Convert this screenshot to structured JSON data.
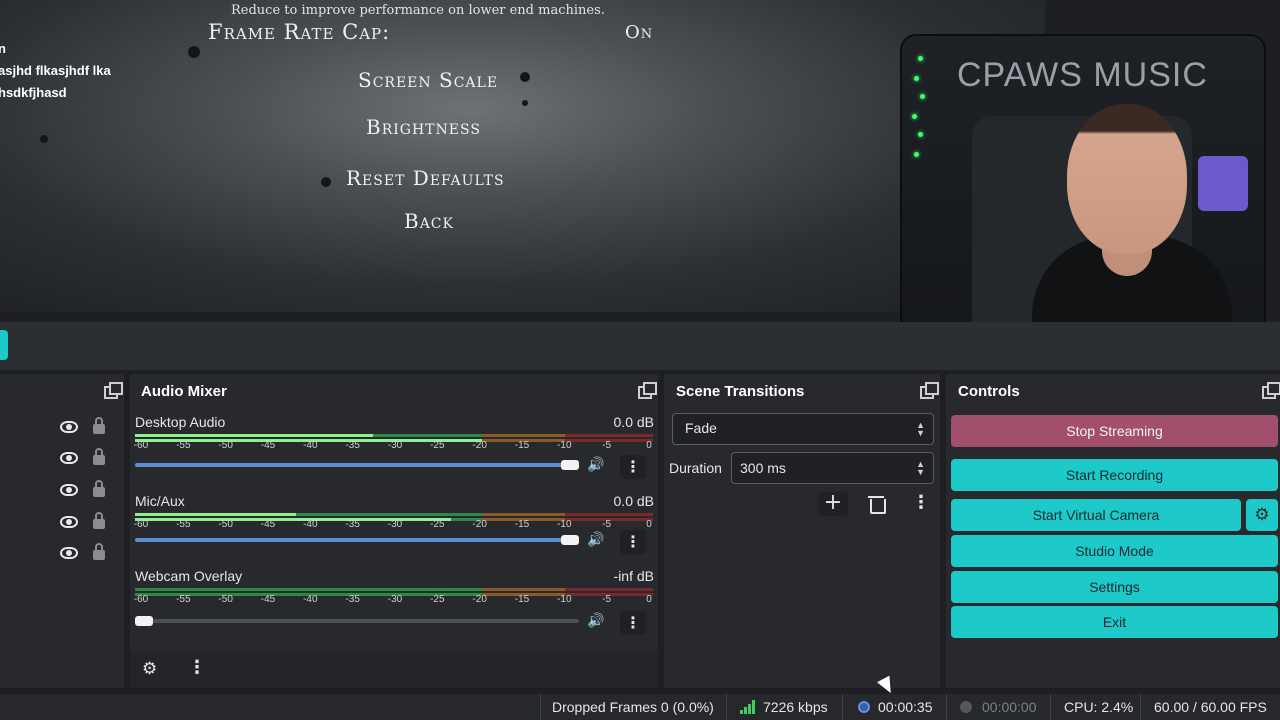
{
  "preview": {
    "settings_note": "Reduce to improve performance on lower end machines.",
    "frame_rate_label": "Frame Rate Cap:",
    "frame_rate_value": "On",
    "menu": [
      "Screen Scale",
      "Brightness",
      "Reset Defaults",
      "Back"
    ],
    "chat_lines": [
      "n",
      "asjhd flkasjhdf lka",
      "hsdkfjhasd"
    ],
    "webcam_logo": "CPAWS MUSIC"
  },
  "sources": {
    "rows": 5
  },
  "audio_mixer": {
    "title": "Audio Mixer",
    "ticks": [
      "-60",
      "-55",
      "-50",
      "-45",
      "-40",
      "-35",
      "-30",
      "-25",
      "-20",
      "-15",
      "-10",
      "-5",
      "0"
    ],
    "channels": [
      {
        "name": "Desktop Audio",
        "db": "0.0 dB",
        "level_1": 0.46,
        "level_2": 0.67,
        "volume": 1.0
      },
      {
        "name": "Mic/Aux",
        "db": "0.0 dB",
        "level_1": 0.31,
        "level_2": 0.61,
        "volume": 1.0
      },
      {
        "name": "Webcam Overlay",
        "db": "-inf dB",
        "level_1": 0.0,
        "level_2": 0.0,
        "volume": 0.0
      }
    ]
  },
  "scene_transitions": {
    "title": "Scene Transitions",
    "selected": "Fade",
    "duration_label": "Duration",
    "duration_value": "300 ms"
  },
  "controls": {
    "title": "Controls",
    "stop_streaming": "Stop Streaming",
    "start_recording": "Start Recording",
    "start_virtual_camera": "Start Virtual Camera",
    "studio_mode": "Studio Mode",
    "settings": "Settings",
    "exit": "Exit"
  },
  "status_bar": {
    "dropped_frames": "Dropped Frames 0 (0.0%)",
    "bitrate": "7226 kbps",
    "stream_time": "00:00:35",
    "record_time": "00:00:00",
    "cpu": "CPU: 2.4%",
    "fps": "60.00 / 60.00 FPS"
  },
  "colors": {
    "accent": "#1ec9c9",
    "streaming": "#a24f6e",
    "volume": "#5b8ed6"
  },
  "icons": [
    "eye-icon",
    "lock-icon",
    "undock-icon",
    "speaker-icon",
    "kebab-icon",
    "gear-icon",
    "plus-icon",
    "trash-icon",
    "signal-icon"
  ]
}
